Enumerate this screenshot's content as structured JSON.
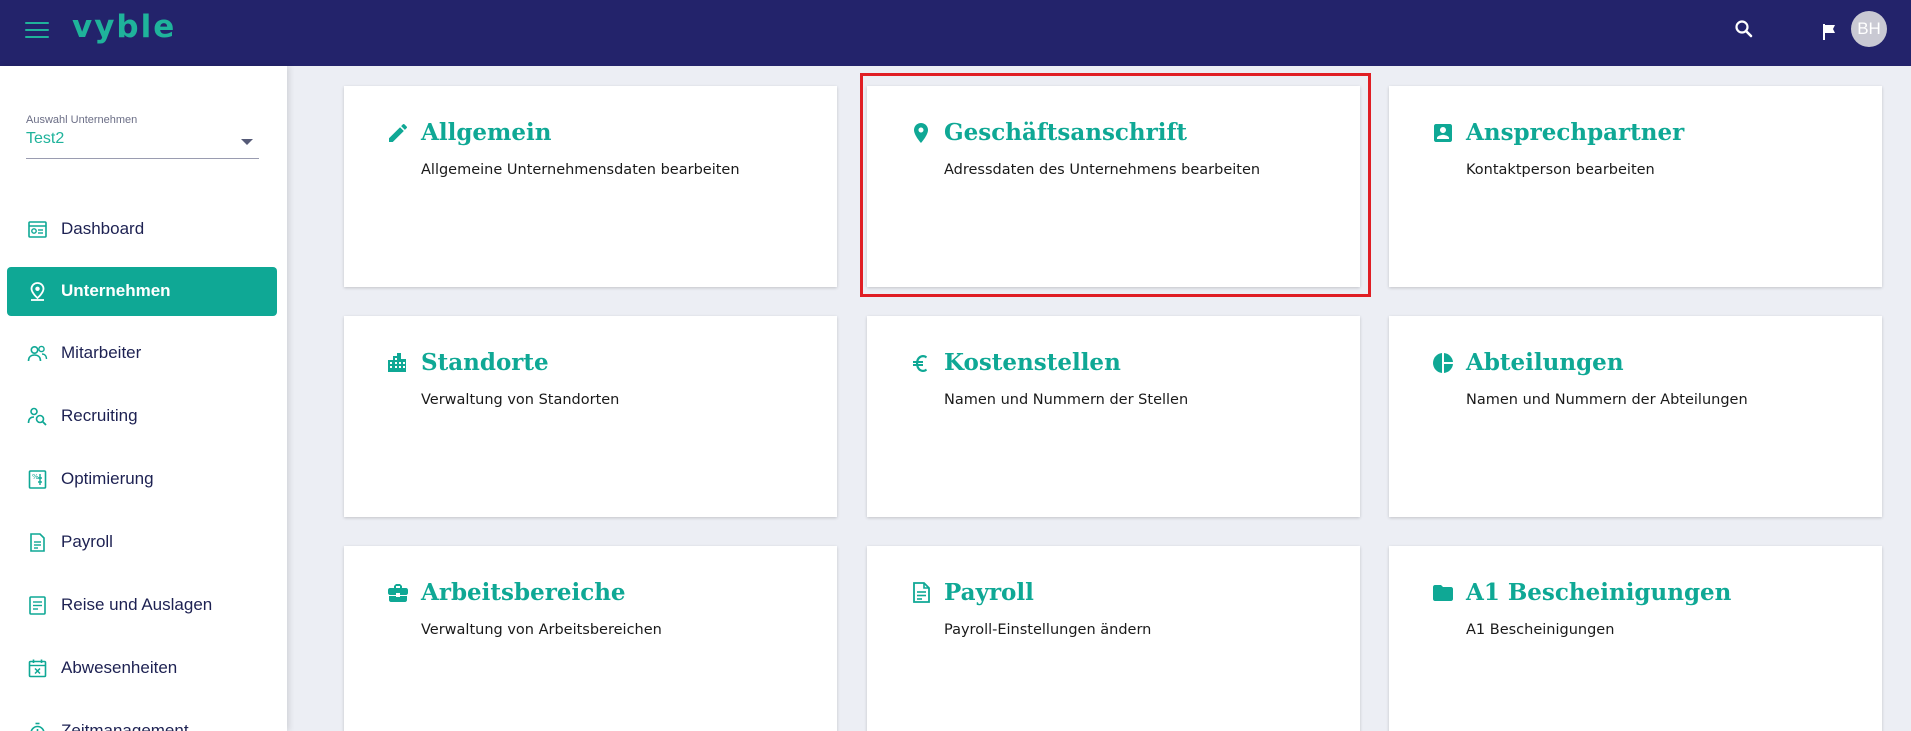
{
  "header": {
    "logo_text": "vyble",
    "avatar_initials": "BH",
    "icons": [
      "menu-icon",
      "search-icon",
      "flag-icon"
    ],
    "background_color": "#23236b",
    "accent_color": "#1fb39b"
  },
  "sidebar": {
    "company_select": {
      "label": "Auswahl Unternehmen",
      "value": "Test2"
    },
    "items": [
      {
        "label": "Dashboard",
        "icon": "dashboard-icon",
        "active": false
      },
      {
        "label": "Unternehmen",
        "icon": "location-pin-icon",
        "active": true
      },
      {
        "label": "Mitarbeiter",
        "icon": "people-icon",
        "active": false
      },
      {
        "label": "Recruiting",
        "icon": "person-search-icon",
        "active": false
      },
      {
        "label": "Optimierung",
        "icon": "optimization-icon",
        "active": false
      },
      {
        "label": "Payroll",
        "icon": "payroll-document-icon",
        "active": false
      },
      {
        "label": "Reise und Auslagen",
        "icon": "receipt-icon",
        "active": false
      },
      {
        "label": "Abwesenheiten",
        "icon": "calendar-cross-icon",
        "active": false
      },
      {
        "label": "Zeitmanagement",
        "icon": "stopwatch-icon",
        "active": false
      }
    ],
    "active_color": "#0fa895"
  },
  "main": {
    "cards": [
      {
        "title": "Allgemein",
        "description": "Allgemeine Unternehmensdaten bearbeiten",
        "icon": "pencil-icon"
      },
      {
        "title": "Geschäftsanschrift",
        "description": "Adressdaten des Unternehmens bearbeiten",
        "icon": "location-pin-icon",
        "highlighted": true
      },
      {
        "title": "Ansprechpartner",
        "description": "Kontaktperson bearbeiten",
        "icon": "contact-card-icon"
      },
      {
        "title": "Standorte",
        "description": "Verwaltung von Standorten",
        "icon": "buildings-icon"
      },
      {
        "title": "Kostenstellen",
        "description": "Namen und Nummern der Stellen",
        "icon": "euro-icon"
      },
      {
        "title": "Abteilungen",
        "description": "Namen und Nummern der Abteilungen",
        "icon": "pie-chart-icon"
      },
      {
        "title": "Arbeitsbereiche",
        "description": "Verwaltung von Arbeitsbereichen",
        "icon": "briefcase-icon"
      },
      {
        "title": "Payroll",
        "description": "Payroll-Einstellungen ändern",
        "icon": "payroll-document-icon"
      },
      {
        "title": "A1 Bescheinigungen",
        "description": "A1 Bescheinigungen",
        "icon": "folder-icon"
      }
    ],
    "title_color": "#0fa895",
    "highlight_color": "#e01e24"
  }
}
